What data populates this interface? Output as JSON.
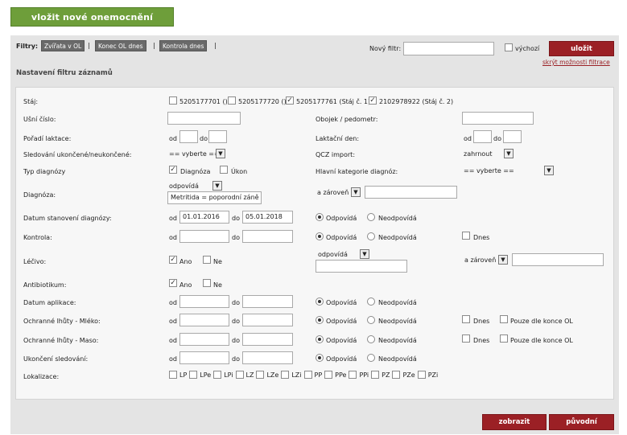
{
  "top_button": "vložit nové onemocnění",
  "filters": {
    "label": "Filtry:",
    "tags": [
      "Zvířata v OL",
      "Konec OL dnes",
      "Kontrola dnes"
    ],
    "sep": "|",
    "new_label": "Nový filtr:",
    "default_label": "výchozí",
    "save": "uložit",
    "hide_link": "skrýt možnosti filtrace"
  },
  "section_title": "Nastavení filtru záznamů",
  "stables": {
    "label": "Stáj:",
    "items": [
      {
        "text": "5205177701 ()",
        "checked": false
      },
      {
        "text": "5205177720 ()",
        "checked": false
      },
      {
        "text": "5205177761 (Stáj č. 1)",
        "checked": true
      },
      {
        "text": "2102978922 (Stáj č. 2)",
        "checked": true
      }
    ]
  },
  "rows": {
    "ear": "Ušní číslo:",
    "collar": "Obojek / pedometr:",
    "lact_order": "Pořadí laktace:",
    "lact_day": "Laktační den:",
    "od": "od",
    "do": "do",
    "tracking": "Sledování ukončené/neukončené:",
    "tracking_val": "== vyberte ==",
    "qcz": "QCZ import:",
    "qcz_val": "zahrnout",
    "diag_type": "Typ diagnózy",
    "diag_opt": "Diagnóza",
    "action_opt": "Úkon",
    "main_cat": "Hlavní kategorie diagnóz:",
    "main_cat_val": "== vyberte ==",
    "diagnosis": "Diagnóza:",
    "matches": "odpovídá",
    "diag_value": "Metritida = poporodní záně",
    "and_also": "a zároveň",
    "date_diag": "Datum stanovení diagnózy:",
    "date_from": "01.01.2016",
    "date_to": "05.01.2018",
    "yes": "Odpovídá",
    "no": "Neodpovídá",
    "control": "Kontrola:",
    "today": "Dnes",
    "drug": "Léčivo:",
    "ano": "Ano",
    "ne": "Ne",
    "antibiotic": "Antibiotikum:",
    "app_date": "Datum aplikace:",
    "milk": "Ochranné lhůty - Mléko:",
    "meat": "Ochranné lhůty - Maso:",
    "only_end": "Pouze dle konce OL",
    "end_track": "Ukončení sledování:",
    "loc": "Lokalizace:",
    "loc_items": [
      "LP",
      "LPe",
      "LPi",
      "LZ",
      "LZe",
      "LZi",
      "PP",
      "PPe",
      "PPi",
      "PZ",
      "PZe",
      "PZi"
    ]
  },
  "bottom": {
    "show": "zobrazit",
    "original": "původní"
  }
}
